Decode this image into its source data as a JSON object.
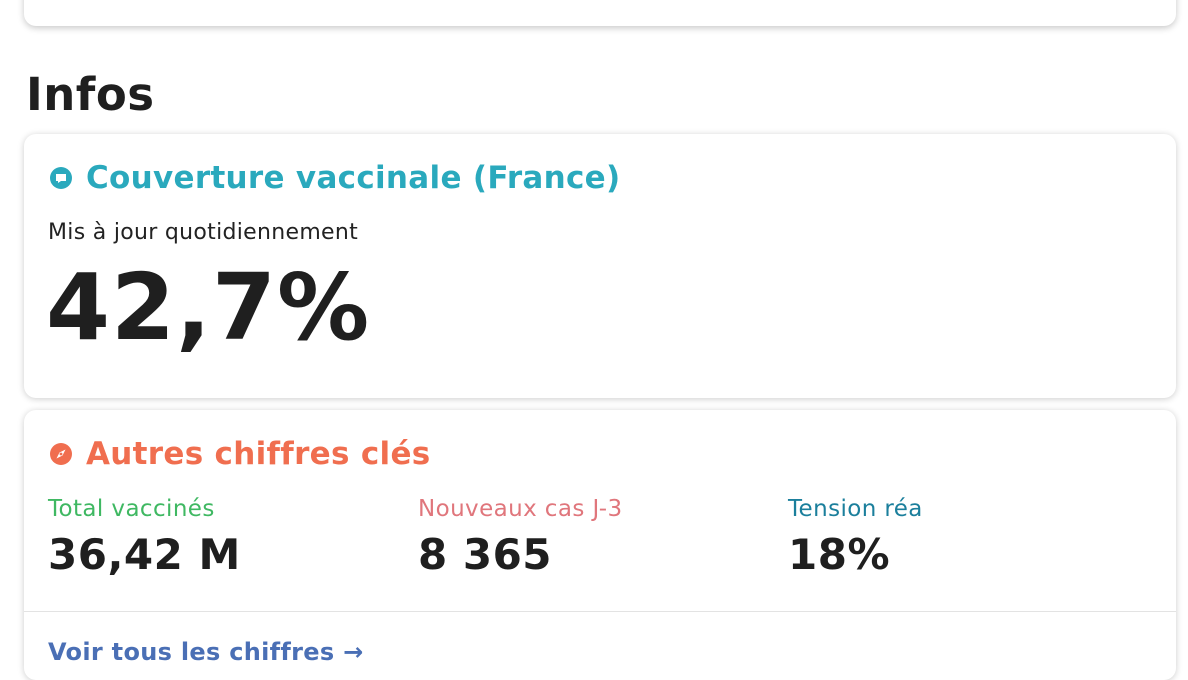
{
  "section": {
    "title": "Infos"
  },
  "vaccine_card": {
    "title": "Couverture vaccinale (France)",
    "subtitle": "Mis à jour quotidiennement",
    "value": "42,7%",
    "accent": "#2aa9bd",
    "icon": "speech-bubble-icon"
  },
  "key_figures": {
    "title": "Autres chiffres clés",
    "accent": "#f06e4f",
    "icon": "compass-icon",
    "stats": [
      {
        "label": "Total vaccinés",
        "value": "36,42 M",
        "color": "#3fb862"
      },
      {
        "label": "Nouveaux cas J-3",
        "value": "8 365",
        "color": "#e0767c"
      },
      {
        "label": "Tension réa",
        "value": "18%",
        "color": "#1b7f9c"
      }
    ],
    "link_label": "Voir tous les chiffres →"
  }
}
